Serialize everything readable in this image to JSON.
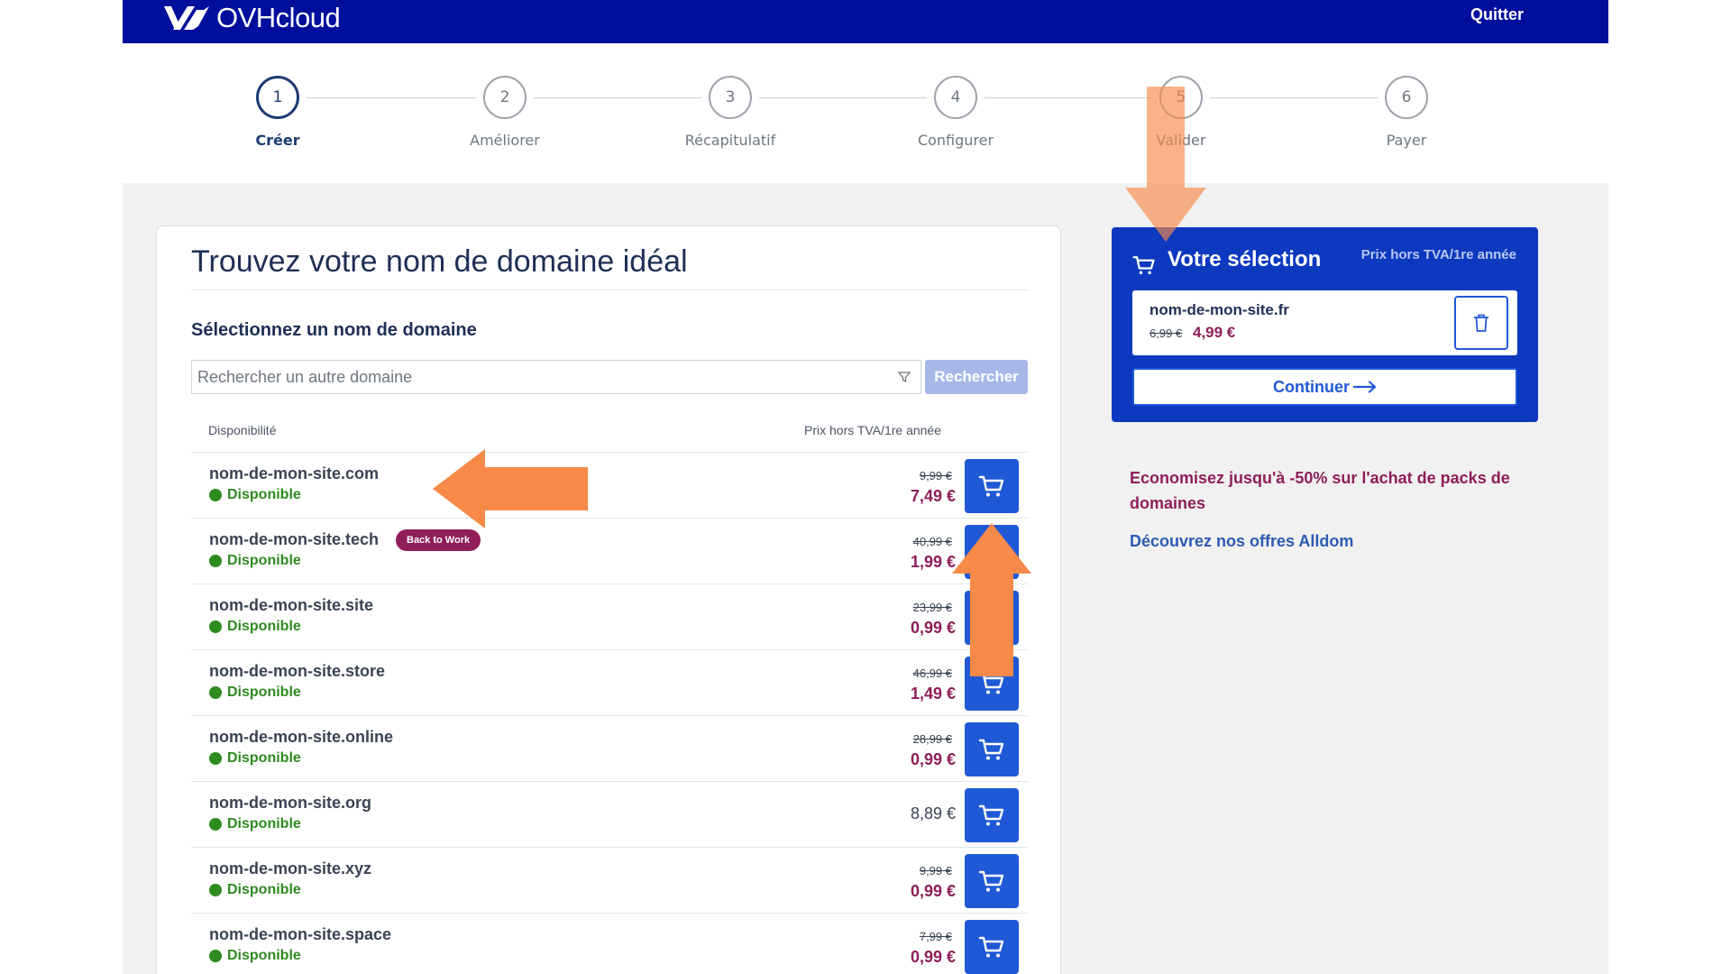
{
  "header": {
    "brand": "OVHcloud",
    "quit_label": "Quitter"
  },
  "steps": [
    {
      "number": "1",
      "label": "Créer",
      "active": true
    },
    {
      "number": "2",
      "label": "Améliorer",
      "active": false
    },
    {
      "number": "3",
      "label": "Récapitulatif",
      "active": false
    },
    {
      "number": "4",
      "label": "Configurer",
      "active": false
    },
    {
      "number": "5",
      "label": "Valider",
      "active": false
    },
    {
      "number": "6",
      "label": "Payer",
      "active": false
    }
  ],
  "main": {
    "title": "Trouvez votre nom de domaine idéal",
    "select_title": "Sélectionnez un nom de domaine",
    "search": {
      "placeholder": "Rechercher un autre domaine",
      "button": "Rechercher"
    },
    "columns": {
      "availability": "Disponibilité",
      "price": "Prix hors TVA/1re année"
    },
    "domains": [
      {
        "name": "nom-de-mon-site.com",
        "status": "Disponible",
        "old_price": "9,99 €",
        "price": "7,49 €",
        "badge": ""
      },
      {
        "name": "nom-de-mon-site.tech",
        "status": "Disponible",
        "old_price": "40,99 €",
        "price": "1,99 €",
        "badge": "Back to Work"
      },
      {
        "name": "nom-de-mon-site.site",
        "status": "Disponible",
        "old_price": "23,99 €",
        "price": "0,99 €",
        "badge": ""
      },
      {
        "name": "nom-de-mon-site.store",
        "status": "Disponible",
        "old_price": "46,99 €",
        "price": "1,49 €",
        "badge": ""
      },
      {
        "name": "nom-de-mon-site.online",
        "status": "Disponible",
        "old_price": "28,99 €",
        "price": "0,99 €",
        "badge": ""
      },
      {
        "name": "nom-de-mon-site.org",
        "status": "Disponible",
        "old_price": "",
        "price": "8,89 €",
        "badge": ""
      },
      {
        "name": "nom-de-mon-site.xyz",
        "status": "Disponible",
        "old_price": "9,99 €",
        "price": "0,99 €",
        "badge": ""
      },
      {
        "name": "nom-de-mon-site.space",
        "status": "Disponible",
        "old_price": "7,99 €",
        "price": "0,99 €",
        "badge": ""
      }
    ]
  },
  "selection": {
    "title": "Votre sélection",
    "price_note": "Prix hors TVA/1re année",
    "item": {
      "name": "nom-de-mon-site.fr",
      "old_price": "6,99 €",
      "price": "4,99 €"
    },
    "continue_label": "Continuer"
  },
  "promo": {
    "text": "Economisez jusqu'à -50% sur l'achat de packs de domaines",
    "link": "Découvrez nos offres Alldom"
  },
  "colors": {
    "header_bg": "#000e9c",
    "primary_blue": "#1f59d6",
    "panel_blue": "#0d39bf",
    "price_purple": "#8f1e59",
    "available_green": "#2e8b1f",
    "annotation_arrow": "#f78a48"
  },
  "icons": [
    "ovh-logo-icon",
    "filter-icon",
    "cart-icon",
    "trash-icon",
    "arrow-right-icon"
  ]
}
